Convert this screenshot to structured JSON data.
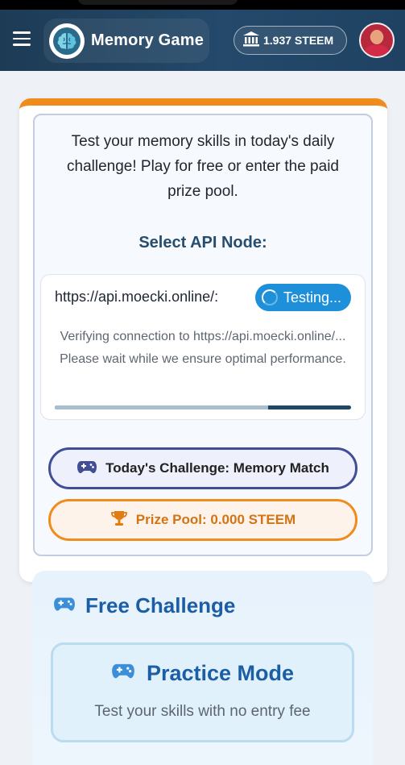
{
  "app": {
    "title": "Memory Game",
    "balance": "1.937 STEEM",
    "menu_icon": "hamburger-icon",
    "logo_icon": "brain-icon",
    "balance_icon": "bank-icon",
    "accent_color": "#f08c1c",
    "header_color": "#1f4262"
  },
  "intro": {
    "text": "Test your memory skills in today's daily challenge! Play for free or enter the paid prize pool."
  },
  "api_node": {
    "label": "Select API Node:",
    "url": "https://api.moecki.online/:",
    "status_button": "Testing...",
    "verify_message": "Verifying connection to https://api.moecki.online/... Please wait while we ensure optimal performance.",
    "progress": 0.72
  },
  "challenge": {
    "label": "Today's Challenge: Memory Match",
    "icon": "gamepad-icon",
    "border_color": "#414e96"
  },
  "prize": {
    "label": "Prize Pool: 0.000 STEEM",
    "icon": "trophy-icon",
    "color": "#f08c1c"
  },
  "free_challenge": {
    "title": "Free Challenge",
    "practice_title": "Practice Mode",
    "practice_subtitle": "Test your skills with no entry fee"
  }
}
